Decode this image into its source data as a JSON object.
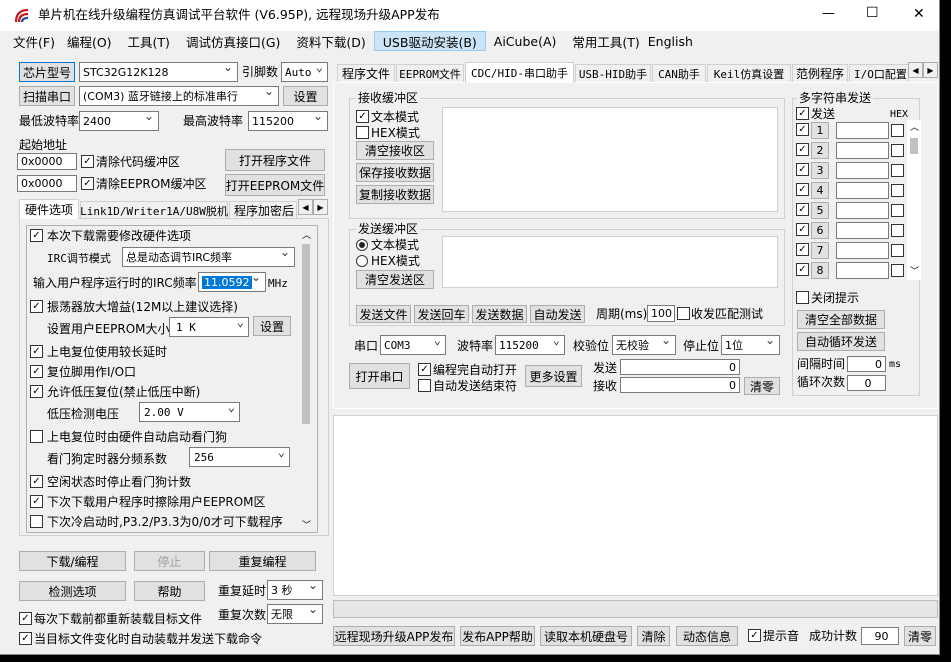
{
  "window": {
    "title": "单片机在线升级编程仿真调试平台软件 (V6.95P), 远程现场升级APP发布",
    "minimize": "—",
    "maximize": "☐",
    "close": "✕"
  },
  "menu": [
    "文件(F)",
    "编程(O)",
    "工具(T)",
    "调试仿真接口(G)",
    "资料下载(D)",
    "USB驱动安装(B)",
    "AiCube(A)",
    "常用工具(T)",
    "English"
  ],
  "left": {
    "chip_btn": "芯片型号",
    "chip_value": "STC32G12K128",
    "pins_label": "引脚数",
    "pins_value": "Auto",
    "scan_btn": "扫描串口",
    "port_value": "(COM3) 蓝牙链接上的标准串行",
    "settings_btn": "设置",
    "min_baud_label": "最低波特率",
    "min_baud_value": "2400",
    "max_baud_label": "最高波特率",
    "max_baud_value": "115200",
    "start_addr_label": "起始地址",
    "addr1": "0x0000",
    "clear_code_label": "清除代码缓冲区",
    "open_prog_btn": "打开程序文件",
    "addr2": "0x0000",
    "clear_eeprom_label": "清除EEPROM缓冲区",
    "open_eeprom_btn": "打开EEPROM文件",
    "tabs": [
      "硬件选项",
      "Link1D/Writer1A/U8W脱机",
      "程序加密后"
    ],
    "hw": {
      "opt1": "本次下载需要修改硬件选项",
      "irc_mode_label": "IRC调节模式",
      "irc_mode_value": "总是动态调节IRC频率",
      "irc_freq_label": "输入用户程序运行时的IRC频率",
      "irc_freq_value": "11.0592",
      "irc_freq_unit": "MHz",
      "opt2": "振荡器放大增益(12M以上建议选择)",
      "eeprom_size_label": "设置用户EEPROM大小",
      "eeprom_size_value": "1   K",
      "eeprom_set_btn": "设置",
      "opt3": "上电复位使用较长延时",
      "opt4": "复位脚用作I/O口",
      "opt5": "允许低压复位(禁止低压中断)",
      "lv_label": "低压检测电压",
      "lv_value": "2.00 V",
      "opt6": "上电复位时由硬件自动启动看门狗",
      "wdt_label": "看门狗定时器分频系数",
      "wdt_value": "256",
      "opt7": "空闲状态时停止看门狗计数",
      "opt8": "下次下载用户程序时擦除用户EEPROM区",
      "opt9": "下次冷启动时,P3.2/P3.3为0/0才可下载程序"
    },
    "download_btn": "下载/编程",
    "stop_btn": "停止",
    "reprog_btn": "重复编程",
    "check_btn": "检测选项",
    "help_btn": "帮助",
    "delay_label": "重复延时",
    "delay_value": "3 秒",
    "count_label": "重复次数",
    "count_value": "无限",
    "reload_label": "每次下载前都重新装载目标文件",
    "auto_label": "当目标文件变化时自动装载并发送下载命令"
  },
  "right": {
    "tabs": [
      "程序文件",
      "EEPROM文件",
      "CDC/HID-串口助手",
      "USB-HID助手",
      "CAN助手",
      "Keil仿真设置",
      "范例程序",
      "I/O口配置"
    ],
    "recv": {
      "title": "接收缓冲区",
      "text_mode": "文本模式",
      "hex_mode": "HEX模式",
      "clear_btn": "清空接收区",
      "save_btn": "保存接收数据",
      "copy_btn": "复制接收数据"
    },
    "send": {
      "title": "发送缓冲区",
      "text_mode": "文本模式",
      "hex_mode": "HEX模式",
      "clear_btn": "清空发送区",
      "send_file_btn": "发送文件",
      "send_return_btn": "发送回车",
      "send_data_btn": "发送数据",
      "auto_send_btn": "自动发送",
      "period_label": "周期(ms)",
      "period_value": "100",
      "match_label": "收发匹配测试"
    },
    "serial": {
      "port_label": "串口",
      "port_value": "COM3",
      "baud_label": "波特率",
      "baud_value": "115200",
      "parity_label": "校验位",
      "parity_value": "无校验",
      "stop_label": "停止位",
      "stop_value": "1位",
      "open_btn": "打开串口",
      "auto_open_label": "编程完自动打开",
      "auto_end_label": "自动发送结束符",
      "more_btn": "更多设置",
      "send_label": "发送",
      "send_count": "0",
      "recv_label": "接收",
      "recv_count": "0",
      "clear_btn": "清零"
    },
    "multi": {
      "title": "多字符串发送",
      "send_col": "发送",
      "hex_col": "HEX",
      "rows": [
        "1",
        "2",
        "3",
        "4",
        "5",
        "6",
        "7",
        "8"
      ],
      "close_tip": "关闭提示",
      "clear_all_btn": "清空全部数据",
      "auto_loop_btn": "自动循环发送",
      "interval_label": "间隔时间",
      "interval_value": "0",
      "interval_unit": "ms",
      "loop_label": "循环次数",
      "loop_value": "0"
    }
  },
  "bottom": {
    "publish_btn": "远程现场升级APP发布",
    "publish_help_btn": "发布APP帮助",
    "read_disk_btn": "读取本机硬盘号",
    "clear_btn": "清除",
    "anim_btn": "动态信息",
    "beep_label": "提示音",
    "success_label": "成功计数",
    "success_value": "90",
    "reset_btn": "清零"
  }
}
